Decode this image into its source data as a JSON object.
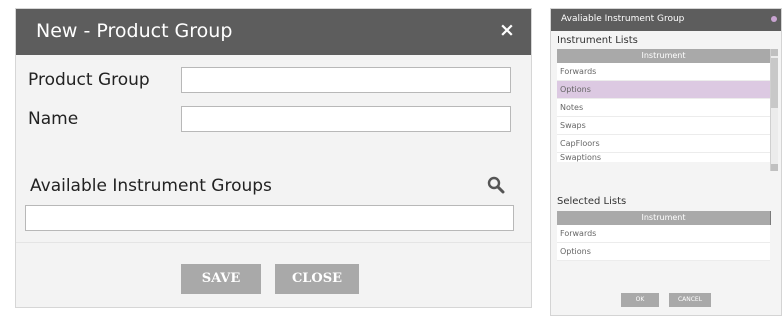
{
  "left_dialog": {
    "title": "New - Product Group",
    "close_glyph": "×",
    "fields": [
      {
        "label": "Product Group",
        "value": ""
      },
      {
        "label": "Name",
        "value": ""
      }
    ],
    "available_label": "Available Instrument Groups",
    "available_value": "",
    "search_icon": "search-icon",
    "save_label": "SAVE",
    "close_label": "CLOSE"
  },
  "right_dialog": {
    "title": "Avaliable Instrument Group",
    "instrument_lists_label": "Instrument Lists",
    "instrument_column": "Instrument",
    "instrument_items": [
      {
        "label": "Forwards",
        "selected": false
      },
      {
        "label": "Options",
        "selected": true
      },
      {
        "label": "Notes",
        "selected": false
      },
      {
        "label": "Swaps",
        "selected": false
      },
      {
        "label": "CapFloors",
        "selected": false
      },
      {
        "label": "Swaptions",
        "selected": false
      }
    ],
    "selected_lists_label": "Selected Lists",
    "selected_column": "Instrument",
    "selected_items": [
      "Forwards",
      "Options"
    ],
    "ok_label": "OK",
    "cancel_label": "CANCEL"
  },
  "colors": {
    "header": "#5d5d5d",
    "button": "#a9a9a9",
    "selected_row": "#dcc9e2"
  }
}
